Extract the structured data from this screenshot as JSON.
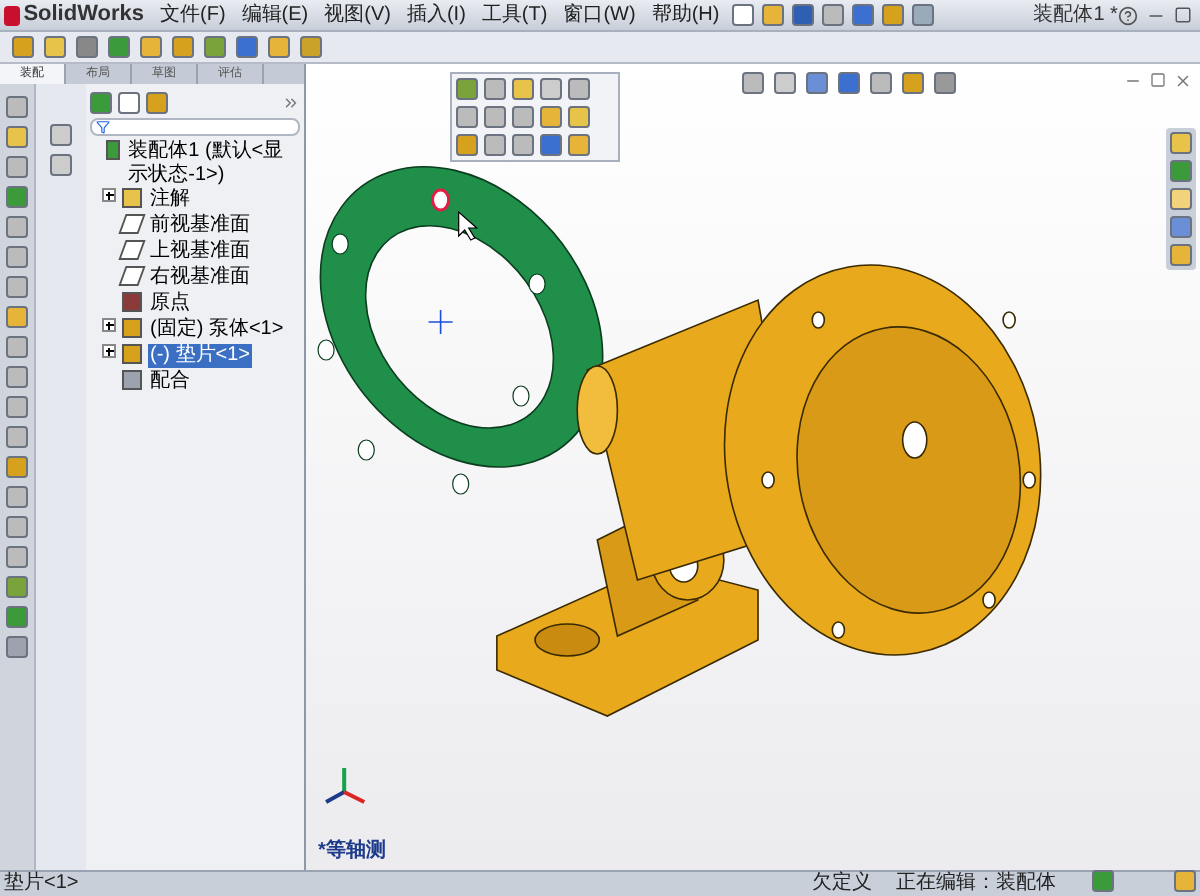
{
  "window": {
    "app_name": "SolidWorks",
    "title": "装配体1 *"
  },
  "menu": [
    "文件(F)",
    "编辑(E)",
    "视图(V)",
    "插入(I)",
    "工具(T)",
    "窗口(W)",
    "帮助(H)"
  ],
  "command_tabs": [
    {
      "label": "装配",
      "selected": true
    },
    {
      "label": "布局",
      "selected": false
    },
    {
      "label": "草图",
      "selected": false
    },
    {
      "label": "评估",
      "selected": false
    }
  ],
  "feature_tree": {
    "items": [
      {
        "label": "装配体1 (默认<显示状态-1>)",
        "kind": "assembly",
        "collapsed": false,
        "selected": false,
        "children": [
          {
            "label": "注解",
            "kind": "annotation",
            "collapsed": true,
            "selected": false
          },
          {
            "label": "前视基准面",
            "kind": "plane",
            "collapsed": false,
            "selected": false
          },
          {
            "label": "上视基准面",
            "kind": "plane",
            "collapsed": false,
            "selected": false
          },
          {
            "label": "右视基准面",
            "kind": "plane",
            "collapsed": false,
            "selected": false
          },
          {
            "label": "原点",
            "kind": "origin",
            "collapsed": false,
            "selected": false
          },
          {
            "label": "(固定) 泵体<1>",
            "kind": "part",
            "collapsed": true,
            "selected": false
          },
          {
            "label": "(-) 垫片<1>",
            "kind": "part",
            "collapsed": true,
            "selected": true
          },
          {
            "label": "配合",
            "kind": "mates",
            "collapsed": false,
            "selected": false
          }
        ]
      }
    ]
  },
  "viewport": {
    "view_label": "*等轴测"
  },
  "status_bar": [
    "垫片<1>",
    "欠定义",
    "正在编辑：装配体"
  ]
}
